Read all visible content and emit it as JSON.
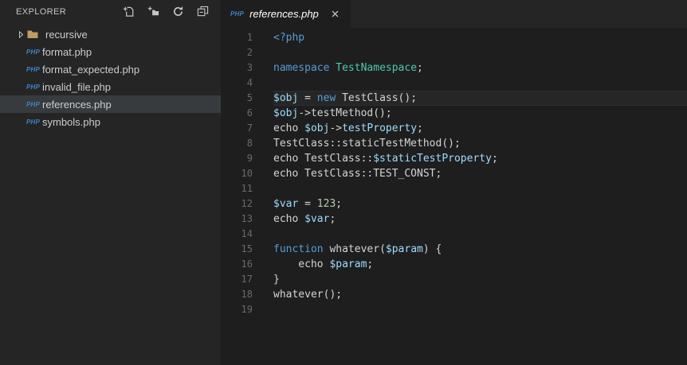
{
  "colors": {
    "sidebar_bg": "#252526",
    "editor_bg": "#1e1e1e",
    "tabbar_bg": "#252526",
    "tab_bg": "#1e1e1e",
    "selection_bg": "#383b3d",
    "current_line_bg": "#262626",
    "icon": "#c5c5c5",
    "php_icon": "#3e82c8",
    "folder_icon": "#c09b62",
    "line_number": "#6a6a6a",
    "text": "#d4d4d4",
    "keyword": "#569cd6",
    "type": "#4ec9b0",
    "variable": "#9cdcfe",
    "number": "#b5cea8"
  },
  "sidebar": {
    "title": "EXPLORER",
    "actions": [
      {
        "name": "new-file"
      },
      {
        "name": "new-folder"
      },
      {
        "name": "refresh"
      },
      {
        "name": "collapse-all"
      }
    ],
    "file_badge": "PHP",
    "items": [
      {
        "type": "folder",
        "label": "recursive",
        "expanded": false,
        "selected": false
      },
      {
        "type": "file",
        "label": "format.php",
        "selected": false
      },
      {
        "type": "file",
        "label": "format_expected.php",
        "selected": false
      },
      {
        "type": "file",
        "label": "invalid_file.php",
        "selected": false
      },
      {
        "type": "file",
        "label": "references.php",
        "selected": true
      },
      {
        "type": "file",
        "label": "symbols.php",
        "selected": false
      }
    ]
  },
  "editor": {
    "tab": {
      "icon": "PHP",
      "label": "references.php",
      "preview": true
    },
    "lines": [
      {
        "num": 1,
        "current": false,
        "tokens": [
          {
            "c": "keyword",
            "t": "<?php"
          }
        ]
      },
      {
        "num": 2,
        "current": false,
        "tokens": []
      },
      {
        "num": 3,
        "current": false,
        "tokens": [
          {
            "c": "keyword",
            "t": "namespace"
          },
          {
            "c": "plain",
            "t": " "
          },
          {
            "c": "type",
            "t": "TestNamespace"
          },
          {
            "c": "plain",
            "t": ";"
          }
        ]
      },
      {
        "num": 4,
        "current": false,
        "tokens": []
      },
      {
        "num": 5,
        "current": true,
        "tokens": [
          {
            "c": "var",
            "t": "$obj"
          },
          {
            "c": "plain",
            "t": " = "
          },
          {
            "c": "keyword",
            "t": "new"
          },
          {
            "c": "plain",
            "t": " TestClass();"
          }
        ]
      },
      {
        "num": 6,
        "current": false,
        "tokens": [
          {
            "c": "var",
            "t": "$obj"
          },
          {
            "c": "plain",
            "t": "->testMethod();"
          }
        ]
      },
      {
        "num": 7,
        "current": false,
        "tokens": [
          {
            "c": "plain",
            "t": "echo "
          },
          {
            "c": "var",
            "t": "$obj"
          },
          {
            "c": "plain",
            "t": "->"
          },
          {
            "c": "var",
            "t": "testProperty"
          },
          {
            "c": "plain",
            "t": ";"
          }
        ]
      },
      {
        "num": 8,
        "current": false,
        "tokens": [
          {
            "c": "plain",
            "t": "TestClass::staticTestMethod();"
          }
        ]
      },
      {
        "num": 9,
        "current": false,
        "tokens": [
          {
            "c": "plain",
            "t": "echo TestClass::"
          },
          {
            "c": "var",
            "t": "$staticTestProperty"
          },
          {
            "c": "plain",
            "t": ";"
          }
        ]
      },
      {
        "num": 10,
        "current": false,
        "tokens": [
          {
            "c": "plain",
            "t": "echo TestClass::TEST_CONST;"
          }
        ]
      },
      {
        "num": 11,
        "current": false,
        "tokens": []
      },
      {
        "num": 12,
        "current": false,
        "tokens": [
          {
            "c": "var",
            "t": "$var"
          },
          {
            "c": "plain",
            "t": " = "
          },
          {
            "c": "num",
            "t": "123"
          },
          {
            "c": "plain",
            "t": ";"
          }
        ]
      },
      {
        "num": 13,
        "current": false,
        "tokens": [
          {
            "c": "plain",
            "t": "echo "
          },
          {
            "c": "var",
            "t": "$var"
          },
          {
            "c": "plain",
            "t": ";"
          }
        ]
      },
      {
        "num": 14,
        "current": false,
        "tokens": []
      },
      {
        "num": 15,
        "current": false,
        "tokens": [
          {
            "c": "keyword",
            "t": "function"
          },
          {
            "c": "plain",
            "t": " whatever("
          },
          {
            "c": "var",
            "t": "$param"
          },
          {
            "c": "plain",
            "t": ") {"
          }
        ]
      },
      {
        "num": 16,
        "current": false,
        "tokens": [
          {
            "c": "plain",
            "t": "    echo "
          },
          {
            "c": "var",
            "t": "$param"
          },
          {
            "c": "plain",
            "t": ";"
          }
        ]
      },
      {
        "num": 17,
        "current": false,
        "tokens": [
          {
            "c": "plain",
            "t": "}"
          }
        ]
      },
      {
        "num": 18,
        "current": false,
        "tokens": [
          {
            "c": "plain",
            "t": "whatever();"
          }
        ]
      },
      {
        "num": 19,
        "current": false,
        "tokens": []
      }
    ]
  }
}
